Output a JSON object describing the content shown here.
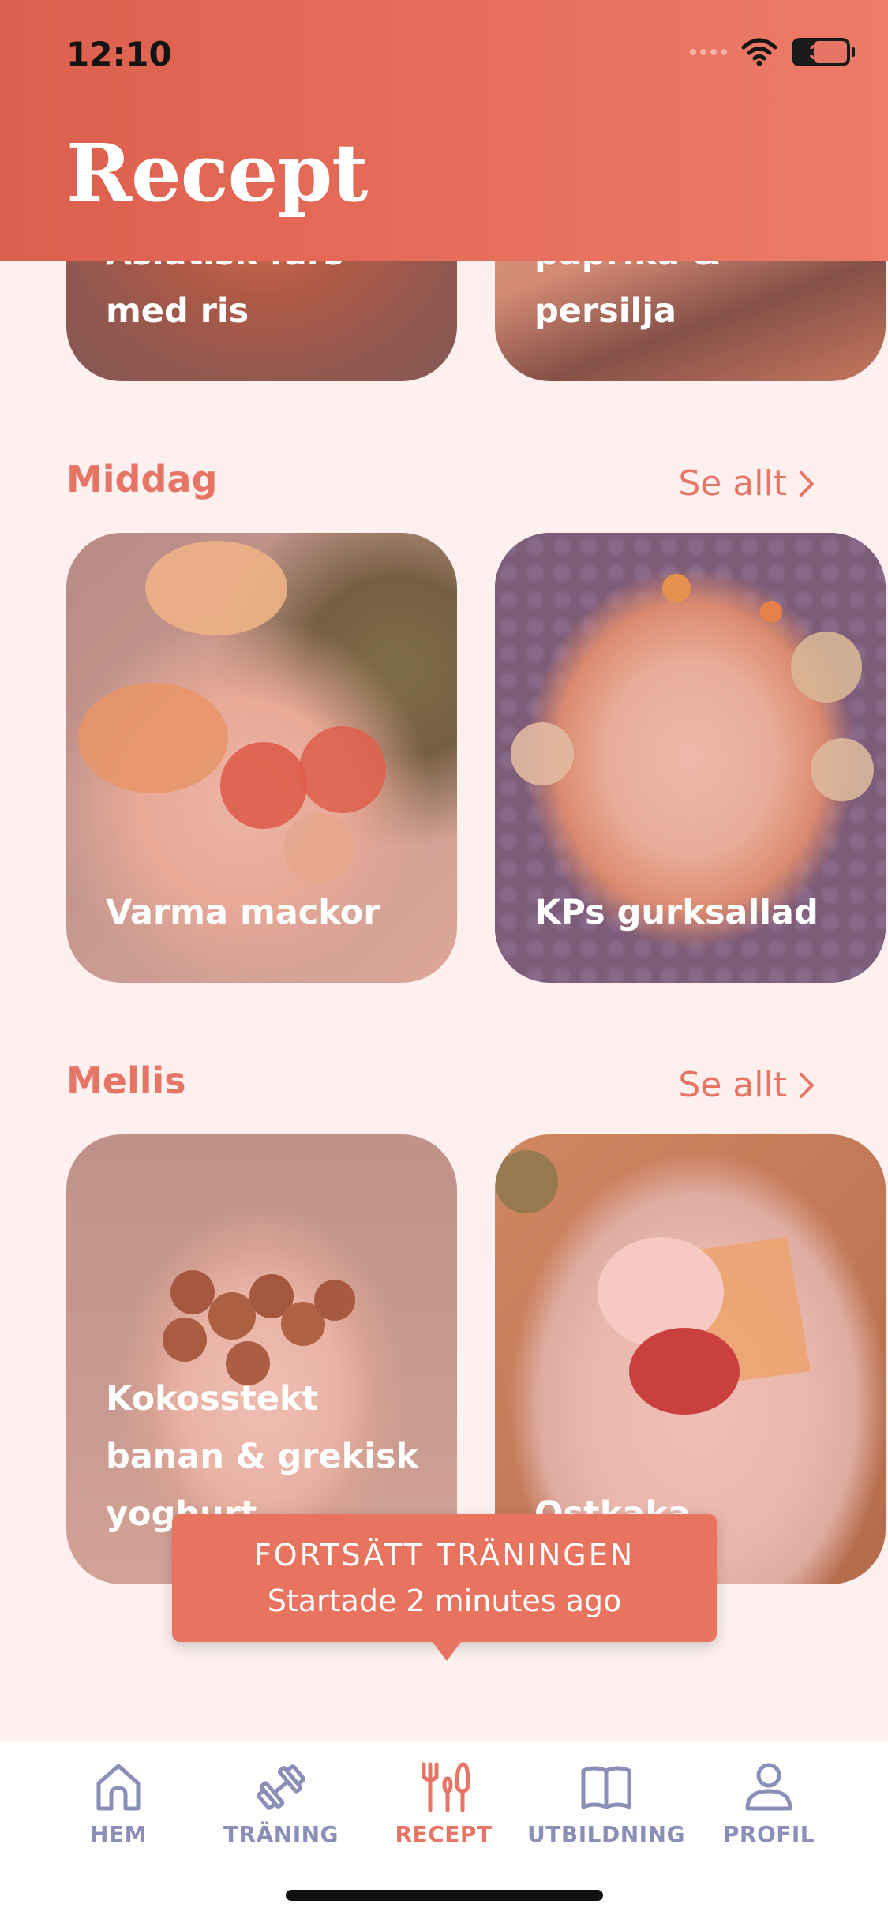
{
  "status": {
    "time": "12:10",
    "battery": "30"
  },
  "header": {
    "title": "Recept"
  },
  "top_cards": [
    {
      "label": "Asiatisk färs med ris"
    },
    {
      "label": "kyckling, paprika & persilja"
    }
  ],
  "sections": [
    {
      "title": "Middag",
      "see_all": "Se allt",
      "cards": [
        {
          "label": "Varma mackor"
        },
        {
          "label": "KPs gurksallad"
        }
      ]
    },
    {
      "title": "Mellis",
      "see_all": "Se allt",
      "cards": [
        {
          "label": "Kokosstekt banan & grekisk yoghurt"
        },
        {
          "label": "Ostkaka"
        }
      ]
    }
  ],
  "toast": {
    "title": "FORTSÄTT TRÄNINGEN",
    "subtitle": "Startade 2 minutes ago"
  },
  "tabs": [
    {
      "label": "HEM",
      "icon": "home-icon",
      "active": false
    },
    {
      "label": "TRÄNING",
      "icon": "dumbbell-icon",
      "active": false
    },
    {
      "label": "RECEPT",
      "icon": "utensils-icon",
      "active": true
    },
    {
      "label": "UTBILDNING",
      "icon": "book-icon",
      "active": false
    },
    {
      "label": "PROFIL",
      "icon": "user-icon",
      "active": false
    }
  ],
  "colors": {
    "accent": "#e77566",
    "header": "#dd5f4d",
    "background": "#fdf0ef",
    "tab_inactive": "#8a8fb7"
  }
}
